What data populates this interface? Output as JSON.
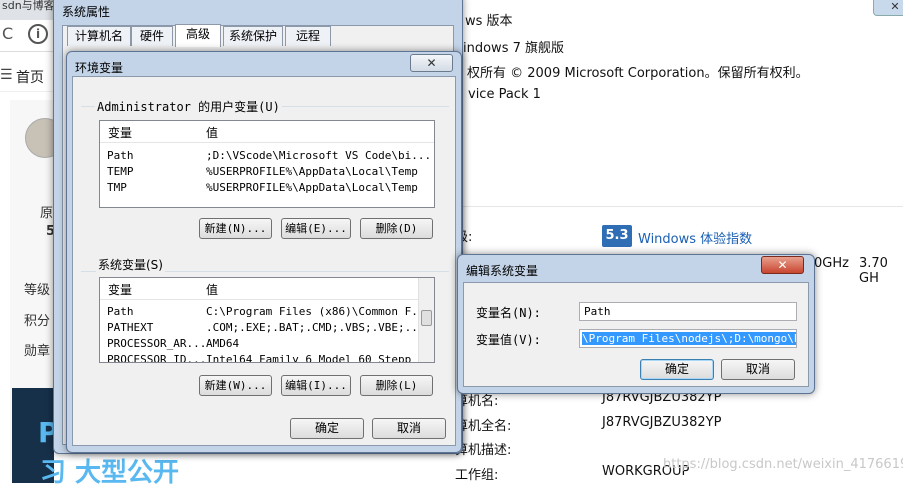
{
  "browser": {
    "tab_text": "sdn与博客",
    "back_glyph": "C",
    "info_glyph": "i",
    "home_label": "首页",
    "side_items": [
      "原",
      "5",
      "等级",
      "积分",
      "勋章"
    ],
    "banner_line1": "Pi",
    "banner_line2": "习 大型公开"
  },
  "sysinfo": {
    "lines": [
      "ws 版本",
      "indows 7 旗舰版",
      "权所有 © 2009 Microsoft Corporation。保留所有权利。",
      "vice Pack 1"
    ],
    "rating_label": "级:",
    "wei_score": "5.3",
    "wei_link": "Windows 体验指数",
    "ghz1": "0GHz",
    "ghz2": "3.70 GH",
    "rows": [
      {
        "label": "算机名:",
        "value": "J87RVGJBZU382YP"
      },
      {
        "label": "算机全名:",
        "value": "J87RVGJBZU382YP"
      },
      {
        "label": "算机描述:",
        "value": ""
      },
      {
        "label": "工作组:",
        "value": "WORKGROUP"
      }
    ],
    "watermark": "https://blog.csdn.net/weixin_41766191"
  },
  "sys_props": {
    "title": "系统属性",
    "tabs": [
      "计算机名",
      "硬件",
      "高级",
      "系统保护",
      "远程"
    ],
    "ok_label": "确定",
    "cancel_label": "取消"
  },
  "env_vars": {
    "title": "环境变量",
    "user_group": "Administrator 的用户变量(U)",
    "col_var": "变量",
    "col_val": "值",
    "user_rows": [
      {
        "name": "Path",
        "value": ";D:\\VScode\\Microsoft VS Code\\bi..."
      },
      {
        "name": "TEMP",
        "value": "%USERPROFILE%\\AppData\\Local\\Temp"
      },
      {
        "name": "TMP",
        "value": "%USERPROFILE%\\AppData\\Local\\Temp"
      }
    ],
    "sys_group": "系统变量(S)",
    "sys_rows": [
      {
        "name": "Path",
        "value": "C:\\Program Files (x86)\\Common F..."
      },
      {
        "name": "PATHEXT",
        "value": ".COM;.EXE;.BAT;.CMD;.VBS;.VBE;...."
      },
      {
        "name": "PROCESSOR_AR...",
        "value": "AMD64"
      },
      {
        "name": "PROCESSOR_ID...",
        "value": "Intel64 Family 6 Model 60 Stepp"
      }
    ],
    "new_user": "新建(N)...",
    "edit_user": "编辑(E)...",
    "del_user": "删除(D)",
    "new_sys": "新建(W)...",
    "edit_sys": "编辑(I)...",
    "del_sys": "删除(L)",
    "ok_label": "确定",
    "cancel_label": "取消"
  },
  "edit_var": {
    "title": "编辑系统变量",
    "name_label": "变量名(N):",
    "name_value": "Path",
    "value_label": "变量值(V):",
    "value_text": "\\Program Files\\nodejs\\;D:\\mongo\\bin",
    "ok_label": "确定",
    "cancel_label": "取消"
  }
}
